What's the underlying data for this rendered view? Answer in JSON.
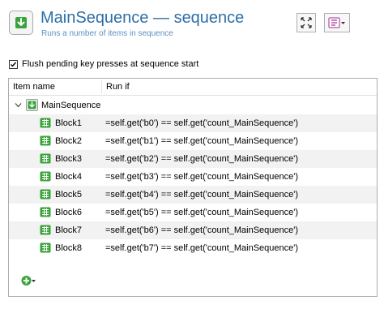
{
  "header": {
    "title_name": "MainSequence",
    "title_separator": " — ",
    "title_type": "sequence",
    "subtitle": "Runs a number of items in sequence",
    "icons": [
      "sequence-down-arrow-icon",
      "fullscreen-icon",
      "menu-dropdown-icon"
    ]
  },
  "options": {
    "flush_label": "Flush pending key presses at sequence start",
    "flush_checked": true
  },
  "tree": {
    "columns": [
      "Item name",
      "Run if"
    ],
    "root_label": "MainSequence",
    "items": [
      {
        "name": "Block1",
        "run_if": "=self.get('b0') == self.get('count_MainSequence')"
      },
      {
        "name": "Block2",
        "run_if": "=self.get('b1') == self.get('count_MainSequence')"
      },
      {
        "name": "Block3",
        "run_if": "=self.get('b2') == self.get('count_MainSequence')"
      },
      {
        "name": "Block4",
        "run_if": "=self.get('b3') == self.get('count_MainSequence')"
      },
      {
        "name": "Block5",
        "run_if": "=self.get('b4') == self.get('count_MainSequence')"
      },
      {
        "name": "Block6",
        "run_if": "=self.get('b5') == self.get('count_MainSequence')"
      },
      {
        "name": "Block7",
        "run_if": "=self.get('b6') == self.get('count_MainSequence')"
      },
      {
        "name": "Block8",
        "run_if": "=self.get('b7') == self.get('count_MainSequence')"
      }
    ]
  },
  "colors": {
    "title": "#2d6fa8",
    "green": "#3aa33a",
    "alt_row": "#f2f2f2"
  }
}
